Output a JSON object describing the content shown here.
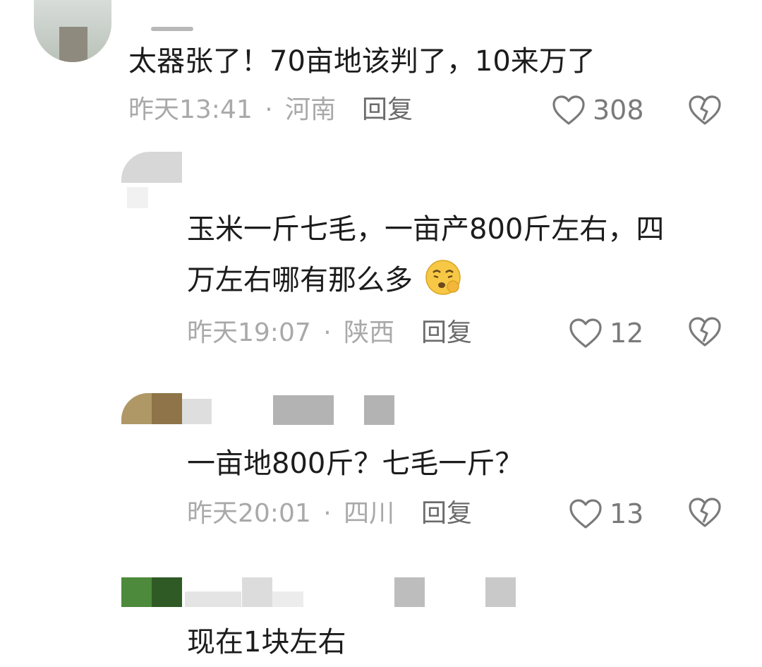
{
  "comments": [
    {
      "text": "太器张了！70亩地该判了，10来万了",
      "time": "昨天13:41",
      "location": "河南",
      "reply_label": "回复",
      "likes": "308"
    },
    {
      "text_line1": "玉米一斤七毛，一亩产800斤左右，四",
      "text_line2": "万左右哪有那么多",
      "time": "昨天19:07",
      "location": "陕西",
      "reply_label": "回复",
      "likes": "12"
    },
    {
      "text": "一亩地800斤？七毛一斤？",
      "time": "昨天20:01",
      "location": "四川",
      "reply_label": "回复",
      "likes": "13"
    },
    {
      "text": "现在1块左右"
    }
  ],
  "separator": "·",
  "colors": {
    "text": "#1c1c1c",
    "meta": "#a9a9a9",
    "reply": "#6b6b6b",
    "icon": "#7a7a7a"
  },
  "icons": [
    "heart-outline-icon",
    "broken-heart-icon",
    "emoji-sleepy-face-icon"
  ]
}
